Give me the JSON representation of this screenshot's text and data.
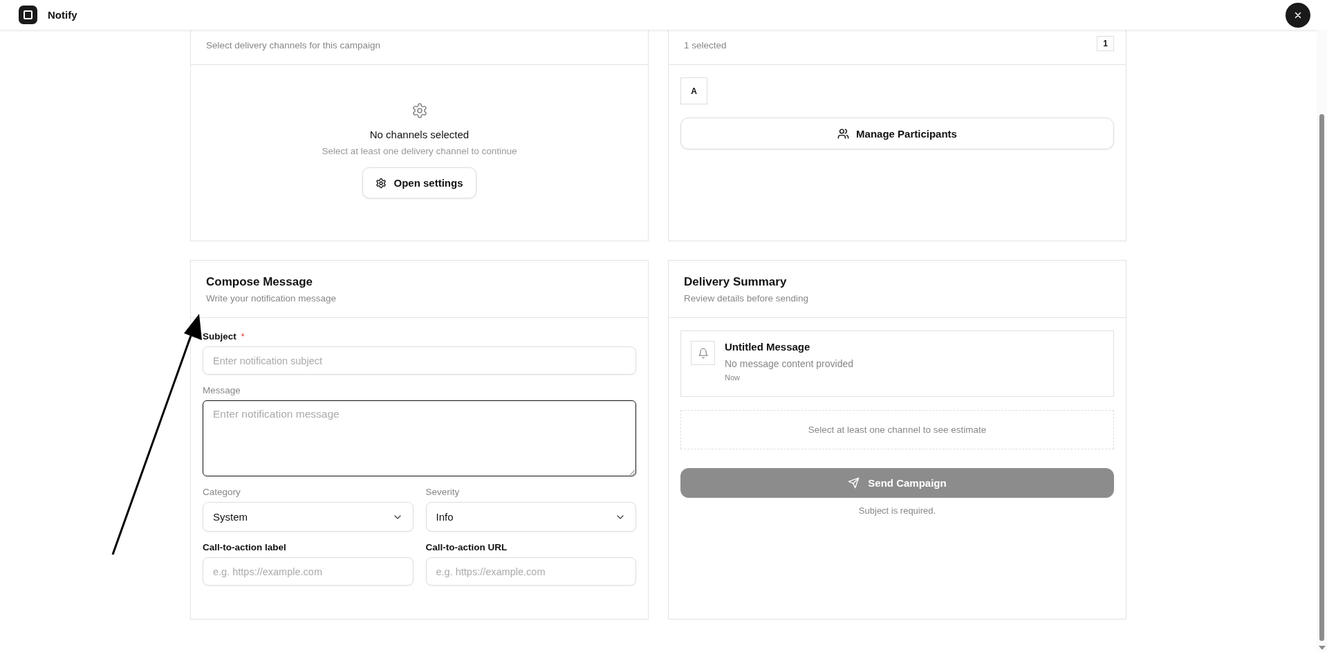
{
  "app": {
    "title": "Notify"
  },
  "channels_card": {
    "subtitle": "Select delivery channels for this campaign",
    "empty_title": "No channels selected",
    "empty_text": "Select at least one delivery channel to continue",
    "button": "Open settings"
  },
  "participants_card": {
    "subtitle": "1 selected",
    "count": "1",
    "participants": [
      {
        "initial": "A"
      }
    ],
    "button": "Manage Participants"
  },
  "compose_card": {
    "title": "Compose Message",
    "subtitle": "Write your notification message",
    "rows": [
      [
        {
          "kind": "text",
          "label": "Subject",
          "label_bold": true,
          "required_mark": "*",
          "placeholder": "Enter notification subject"
        }
      ],
      [
        {
          "kind": "textarea",
          "label": "Message",
          "label_bold": false,
          "placeholder": "Enter notification message",
          "focused": true
        }
      ],
      [
        {
          "kind": "select",
          "label": "Category",
          "label_bold": false,
          "value": "System"
        },
        {
          "kind": "select",
          "label": "Severity",
          "label_bold": false,
          "value": "Info"
        }
      ],
      [
        {
          "kind": "text",
          "label": "Call-to-action label",
          "label_bold": true,
          "placeholder": "e.g. https://example.com"
        },
        {
          "kind": "text",
          "label": "Call-to-action URL",
          "label_bold": true,
          "placeholder": "e.g. https://example.com"
        }
      ]
    ]
  },
  "summary_card": {
    "title": "Delivery Summary",
    "subtitle": "Review details before sending",
    "preview": {
      "title": "Untitled Message",
      "text": "No message content provided",
      "time": "Now"
    },
    "estimate": "Select at least one channel to see estimate",
    "send_button": {
      "label": "Send Campaign",
      "disabled": true
    },
    "note": "Subject is required."
  }
}
